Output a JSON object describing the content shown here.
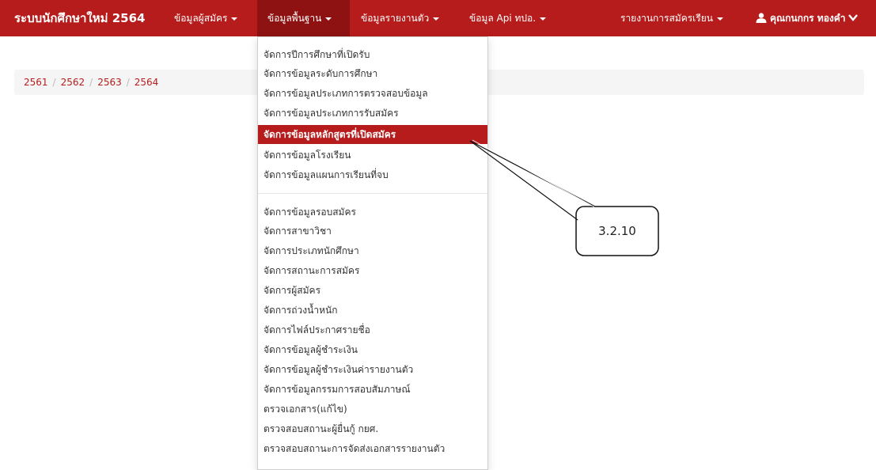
{
  "navbar": {
    "brand": "ระบบนักศึกษาใหม่ 2564",
    "items": [
      {
        "label": "ข้อมูลผู้สมัคร"
      },
      {
        "label": "ข้อมูลพื้นฐาน"
      },
      {
        "label": "ข้อมูลรายงานตัว"
      },
      {
        "label": "ข้อมูล Api ทปอ."
      },
      {
        "label": "รายงานการสมัครเรียน"
      }
    ],
    "user": "คุณกนกกร ทองคำ",
    "colors": {
      "bar": "#b71c1c",
      "active": "#8e1212"
    }
  },
  "breadcrumb": [
    "2561",
    "2562",
    "2563",
    "2564"
  ],
  "dropdown": {
    "group1": [
      "จัดการปีการศึกษาที่เปิดรับ",
      "จัดการข้อมูลระดับการศึกษา",
      "จัดการข้อมูลประเภทการตรวจสอบข้อมูล",
      "จัดการข้อมูลประเภทการรับสมัคร",
      "จัดการข้อมูลหลักสูตรที่เปิดสมัคร",
      "จัดการข้อมูลโรงเรียน",
      "จัดการข้อมูลแผนการเรียนที่จบ"
    ],
    "group2": [
      "จัดการข้อมูลรอบสมัคร",
      "จัดการสาขาวิชา",
      "จัดการประเภทนักศึกษา",
      "จัดการสถานะการสมัคร",
      "จัดการผู้สมัคร",
      "จัดการถ่วงน้ำหนัก",
      "จัดการไฟล์ประกาศรายชื่อ",
      "จัดการข้อมูลผู้ชำระเงิน",
      "จัดการข้อมูลผู้ชำระเงินค่ารายงานตัว",
      "จัดการข้อมูลกรรมการสอบสัมภาษณ์",
      "ตรวจเอกสาร(แก้ไข)",
      "ตรวจสอบสถานะผู้ยื่นกู้ กยศ.",
      "ตรวจสอบสถานะการจัดส่งเอกสารรายงานตัว"
    ],
    "highlighted": "จัดการข้อมูลหลักสูตรที่เปิดสมัคร"
  },
  "callout": {
    "label": "3.2.10"
  },
  "icons": {
    "user": "user-icon",
    "chevron": "chevron-down-icon"
  }
}
